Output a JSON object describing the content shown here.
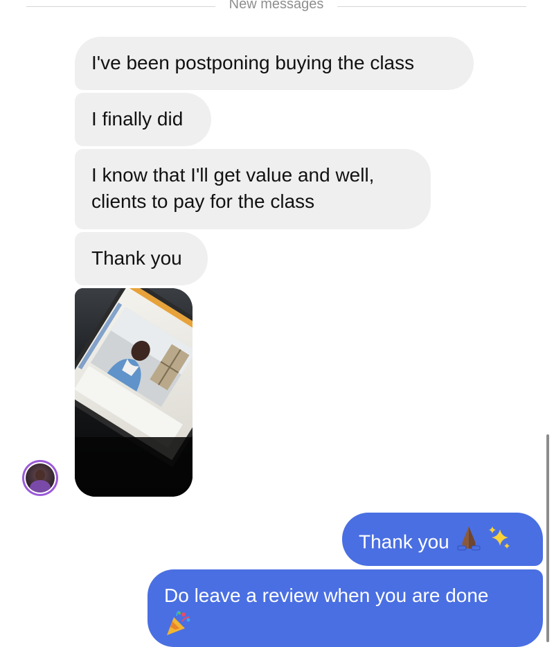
{
  "divider": {
    "label": "New messages"
  },
  "incoming": {
    "messages": [
      {
        "text": "I've been postponing buying the class"
      },
      {
        "text": "I finally did"
      },
      {
        "text": "I know that I'll get value and well, clients to pay for the class"
      },
      {
        "text": "Thank you"
      }
    ],
    "photo_icon": "photo-attachment",
    "avatar_icon": "sender-avatar"
  },
  "outgoing": {
    "messages": [
      {
        "text": "Thank you",
        "emoji": [
          "folded-hands-icon",
          "sparkles-icon"
        ]
      },
      {
        "text": "Do leave a review when you are done",
        "emoji": [
          "party-popper-icon"
        ]
      }
    ]
  },
  "colors": {
    "incoming_bubble": "#efefef",
    "outgoing_bubble": "#4a6fe2",
    "avatar_ring": "#9b59d9"
  }
}
